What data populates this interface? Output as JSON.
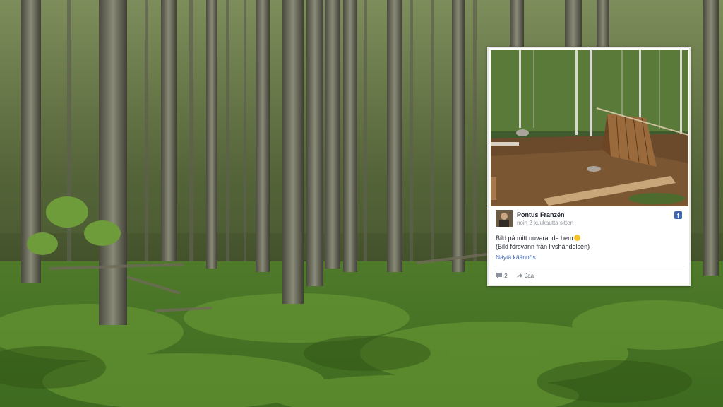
{
  "post": {
    "author": "Pontus Franzén",
    "timestamp": "noin 2 kuukautta sitten",
    "text_line1": "Bild på mitt nuvarande hem",
    "text_line2": "(Bild försvann från livshändelsen)",
    "translate_link": "Näytä käännös",
    "comment_count": "2",
    "share_label": "Jaa",
    "platform_icon": "facebook-icon"
  },
  "colors": {
    "facebook_blue": "#4267b2",
    "link_blue": "#4267b2",
    "card_bg": "#ffffff",
    "text_dark": "#1d2129",
    "text_muted": "#90949c"
  }
}
